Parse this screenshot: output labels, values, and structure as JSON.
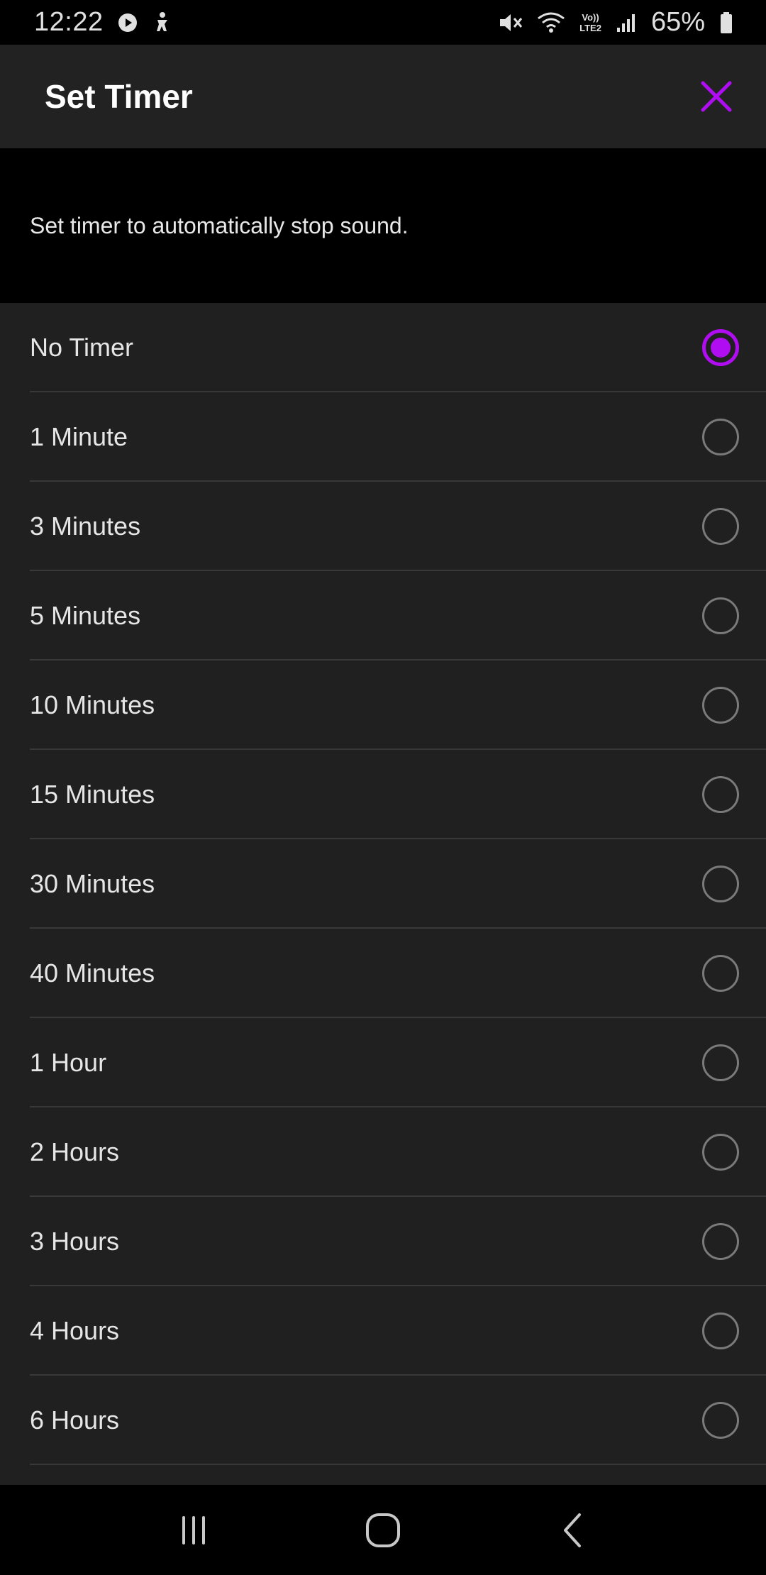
{
  "status_bar": {
    "time": "12:22",
    "battery_percent": "65%",
    "network_label_top": "Vo))",
    "network_label_bottom": "LTE2",
    "icons": [
      "play-icon",
      "accessibility-icon",
      "mute-icon",
      "wifi-icon",
      "signal-icon",
      "battery-icon"
    ]
  },
  "header": {
    "title": "Set Timer",
    "close_icon": "close-icon"
  },
  "description": "Set timer to automatically stop sound.",
  "options": [
    {
      "label": "No Timer",
      "selected": true
    },
    {
      "label": "1 Minute",
      "selected": false
    },
    {
      "label": "3 Minutes",
      "selected": false
    },
    {
      "label": "5 Minutes",
      "selected": false
    },
    {
      "label": "10 Minutes",
      "selected": false
    },
    {
      "label": "15 Minutes",
      "selected": false
    },
    {
      "label": "30 Minutes",
      "selected": false
    },
    {
      "label": "40 Minutes",
      "selected": false
    },
    {
      "label": "1 Hour",
      "selected": false
    },
    {
      "label": "2 Hours",
      "selected": false
    },
    {
      "label": "3 Hours",
      "selected": false
    },
    {
      "label": "4 Hours",
      "selected": false
    },
    {
      "label": "6 Hours",
      "selected": false
    }
  ],
  "colors": {
    "accent": "#b10df2",
    "app_bar": "#222223",
    "list_background": "#202021",
    "background": "#000000"
  },
  "nav_bar": {
    "icons": [
      "recents-icon",
      "home-icon",
      "back-icon"
    ]
  }
}
